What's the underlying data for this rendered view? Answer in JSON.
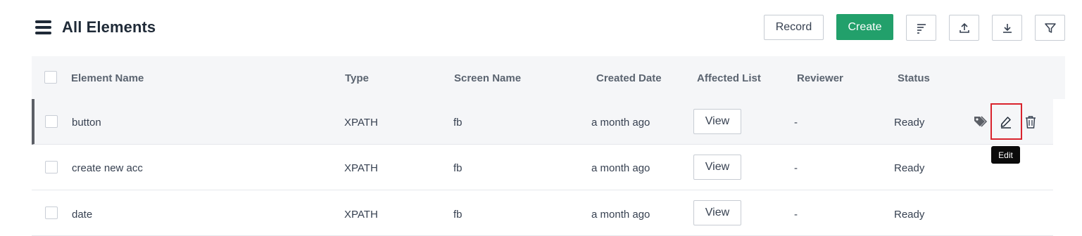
{
  "header": {
    "title": "All Elements",
    "record_label": "Record",
    "create_label": "Create",
    "brand_color": "#22a06b"
  },
  "toolbar_icons": [
    "sort-icon",
    "upload-icon",
    "download-icon",
    "filter-icon"
  ],
  "table": {
    "columns": [
      "Element Name",
      "Type",
      "Screen Name",
      "Created Date",
      "Affected List",
      "Reviewer",
      "Status"
    ],
    "rows": [
      {
        "name": "button",
        "type": "XPATH",
        "screen": "fb",
        "created": "a month ago",
        "affected": "View",
        "reviewer": "-",
        "status": "Ready"
      },
      {
        "name": "create new acc",
        "type": "XPATH",
        "screen": "fb",
        "created": "a month ago",
        "affected": "View",
        "reviewer": "-",
        "status": "Ready"
      },
      {
        "name": "date",
        "type": "XPATH",
        "screen": "fb",
        "created": "a month ago",
        "affected": "View",
        "reviewer": "-",
        "status": "Ready"
      }
    ]
  },
  "row_actions": [
    "tag-icon",
    "edit-icon",
    "delete-icon"
  ],
  "tooltip": {
    "text": "Edit"
  },
  "highlight_color": "#d9232d"
}
